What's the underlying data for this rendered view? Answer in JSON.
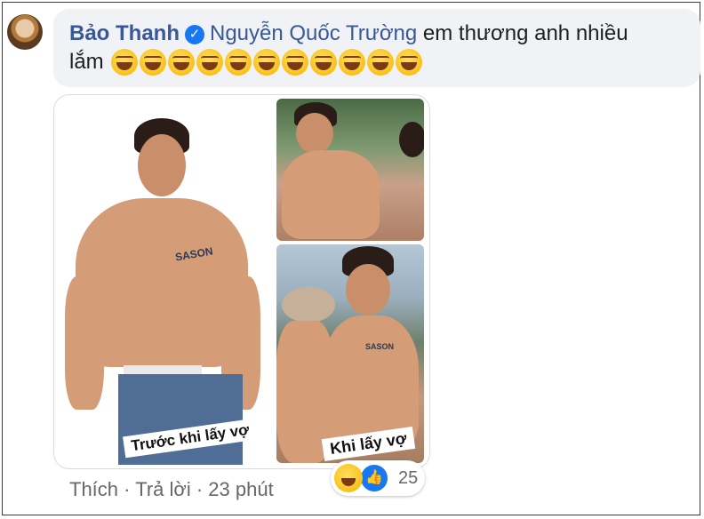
{
  "comment": {
    "author": "Bảo Thanh",
    "mention": "Nguyễn Quốc Trường",
    "text_line1": "em thương anh nhiều",
    "text_line2": "lắm",
    "emoji_count": 11,
    "emoji": "rolling-on-floor-laughing"
  },
  "attachment": {
    "caption_before": "Trước khi lấy vợ",
    "caption_after": "Khi lấy vợ",
    "logo_text": "SASON"
  },
  "actions": {
    "like": "Thích",
    "reply": "Trả lời",
    "time": "23 phút",
    "separator": "·"
  },
  "reactions": {
    "types": [
      "haha",
      "like"
    ],
    "count": "25"
  },
  "colors": {
    "link": "#385898",
    "bubble": "#f0f2f5",
    "meta": "#65676b",
    "verified": "#1877f2"
  }
}
